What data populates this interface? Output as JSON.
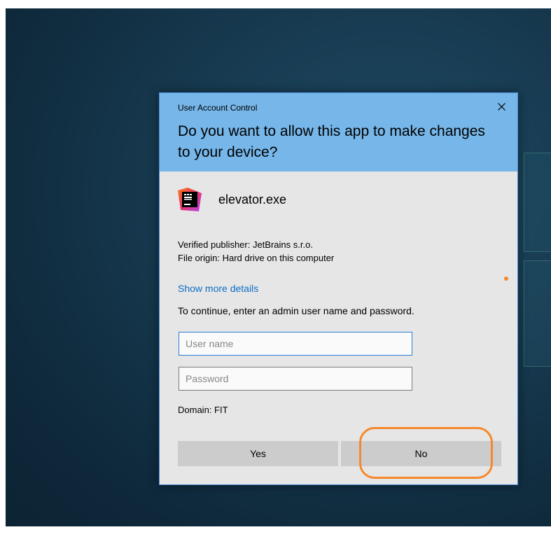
{
  "dialog": {
    "caption": "User Account Control",
    "question": "Do you want to allow this app to make changes to your device?",
    "app_name": "elevator.exe",
    "app_icon": "jetbrains-icon",
    "publisher": "Verified publisher: JetBrains s.r.o.",
    "origin": "File origin: Hard drive on this computer",
    "details_link": "Show more details",
    "instruction": "To continue, enter an admin user name and password.",
    "username": {
      "value": "",
      "placeholder": "User name"
    },
    "password": {
      "value": "",
      "placeholder": "Password"
    },
    "domain": "Domain: FIT",
    "yes_label": "Yes",
    "no_label": "No"
  },
  "colors": {
    "header": "#76b6e9",
    "body": "#e6e6e6",
    "link": "#0c6cc6",
    "annotation": "#f5882c",
    "button": "#cccccc"
  }
}
